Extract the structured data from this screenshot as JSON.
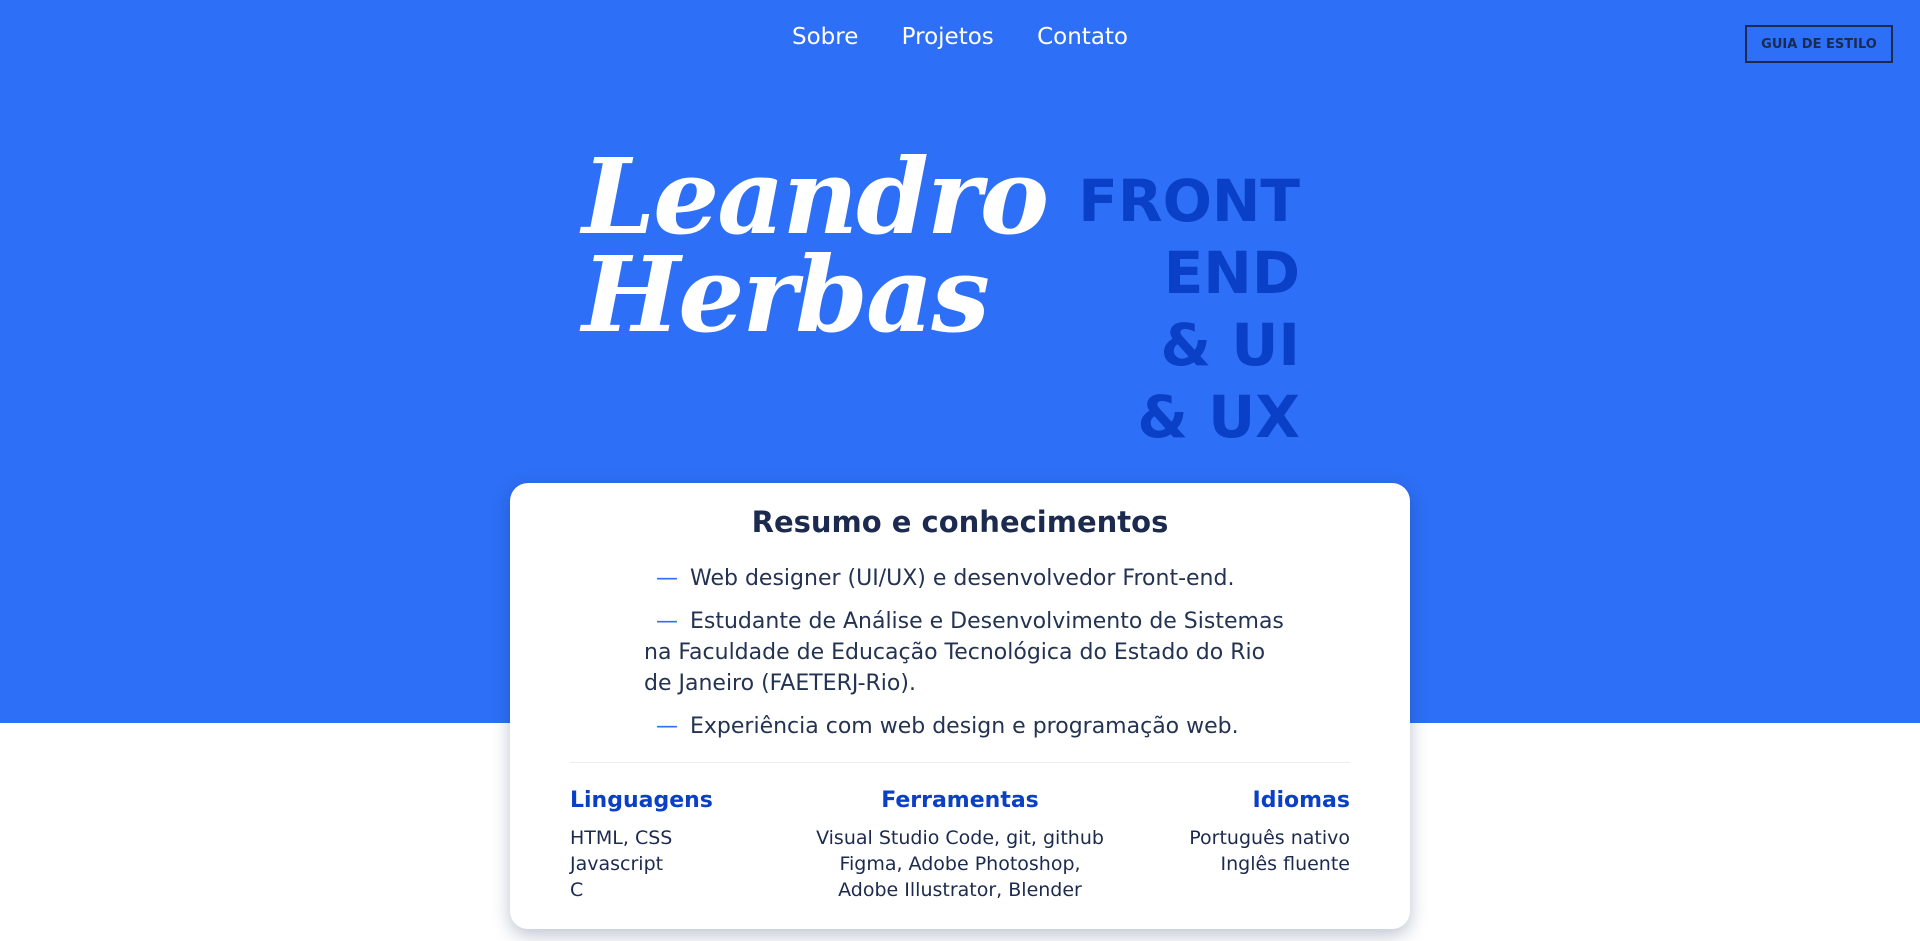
{
  "nav": {
    "items": [
      {
        "label": "Sobre"
      },
      {
        "label": "Projetos"
      },
      {
        "label": "Contato"
      }
    ],
    "style_guide_label": "GUIA DE ESTILO"
  },
  "hero": {
    "name_line1": "Leandro",
    "name_line2": "Herbas",
    "role_lines": [
      "FRONT END",
      "& UI",
      "& UX"
    ]
  },
  "summary": {
    "title": "Resumo e conhecimentos",
    "dash": "—",
    "items": [
      {
        "text": "Web designer (UI/UX) e desenvolvedor Front-end."
      },
      {
        "text": "Estudante de Análise e Desenvolvimento de Sistemas na Faculdade de Educação Tecnológica do Estado do Rio de Janeiro (FAETERJ-Rio)."
      },
      {
        "text": "Experiência com web design e programação web."
      }
    ]
  },
  "skills": {
    "languages": {
      "title": "Linguagens",
      "lines": [
        "HTML, CSS",
        "Javascript",
        "C"
      ]
    },
    "tools": {
      "title": "Ferramentas",
      "lines": [
        "Visual Studio Code, git, github",
        "Figma, Adobe Photoshop,",
        "Adobe Illustrator, Blender"
      ]
    },
    "idioms": {
      "title": "Idiomas",
      "lines": [
        "Português nativo",
        "Inglês fluente"
      ]
    }
  },
  "colors": {
    "hero_bg": "#2d6ff6",
    "accent_dark_blue": "#0a3fc7",
    "text_dark": "#1b2a4e"
  }
}
